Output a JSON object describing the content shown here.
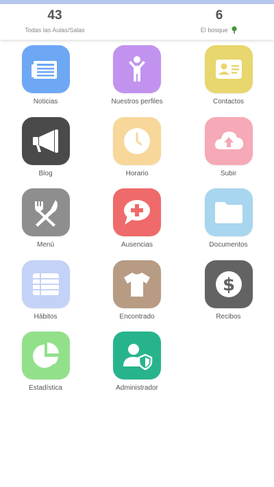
{
  "stats": {
    "left": {
      "value": "43",
      "label": "Todas las Aulas/Salas"
    },
    "right": {
      "value": "6",
      "label": "El bosque",
      "icon": "tree-icon"
    }
  },
  "tiles": [
    {
      "label": "Noticias",
      "icon": "newspaper-icon",
      "color": "#6ea8f5"
    },
    {
      "label": "Nuestros perfiles",
      "icon": "person-icon",
      "color": "#c293ee"
    },
    {
      "label": "Contactos",
      "icon": "contact-card-icon",
      "color": "#e8d66e"
    },
    {
      "label": "Blog",
      "icon": "megaphone-icon",
      "color": "#4a4a4a"
    },
    {
      "label": "Horario",
      "icon": "clock-icon",
      "color": "#f7d79a"
    },
    {
      "label": "Subir",
      "icon": "cloud-upload-icon",
      "color": "#f6a9b6"
    },
    {
      "label": "Menú",
      "icon": "fork-knife-icon",
      "color": "#8e8e8e"
    },
    {
      "label": "Ausencias",
      "icon": "medical-chat-icon",
      "color": "#ef6a6a"
    },
    {
      "label": "Documentos",
      "icon": "folder-icon",
      "color": "#a8d6ee"
    },
    {
      "label": "Hábitos",
      "icon": "table-icon",
      "color": "#c3d2f6"
    },
    {
      "label": "Encontrado",
      "icon": "tshirt-icon",
      "color": "#b79b83"
    },
    {
      "label": "Recibos",
      "icon": "dollar-icon",
      "color": "#636363"
    },
    {
      "label": "Estadística",
      "icon": "pie-chart-icon",
      "color": "#93e08b"
    },
    {
      "label": "Administrador",
      "icon": "admin-shield-icon",
      "color": "#27b48d"
    }
  ]
}
